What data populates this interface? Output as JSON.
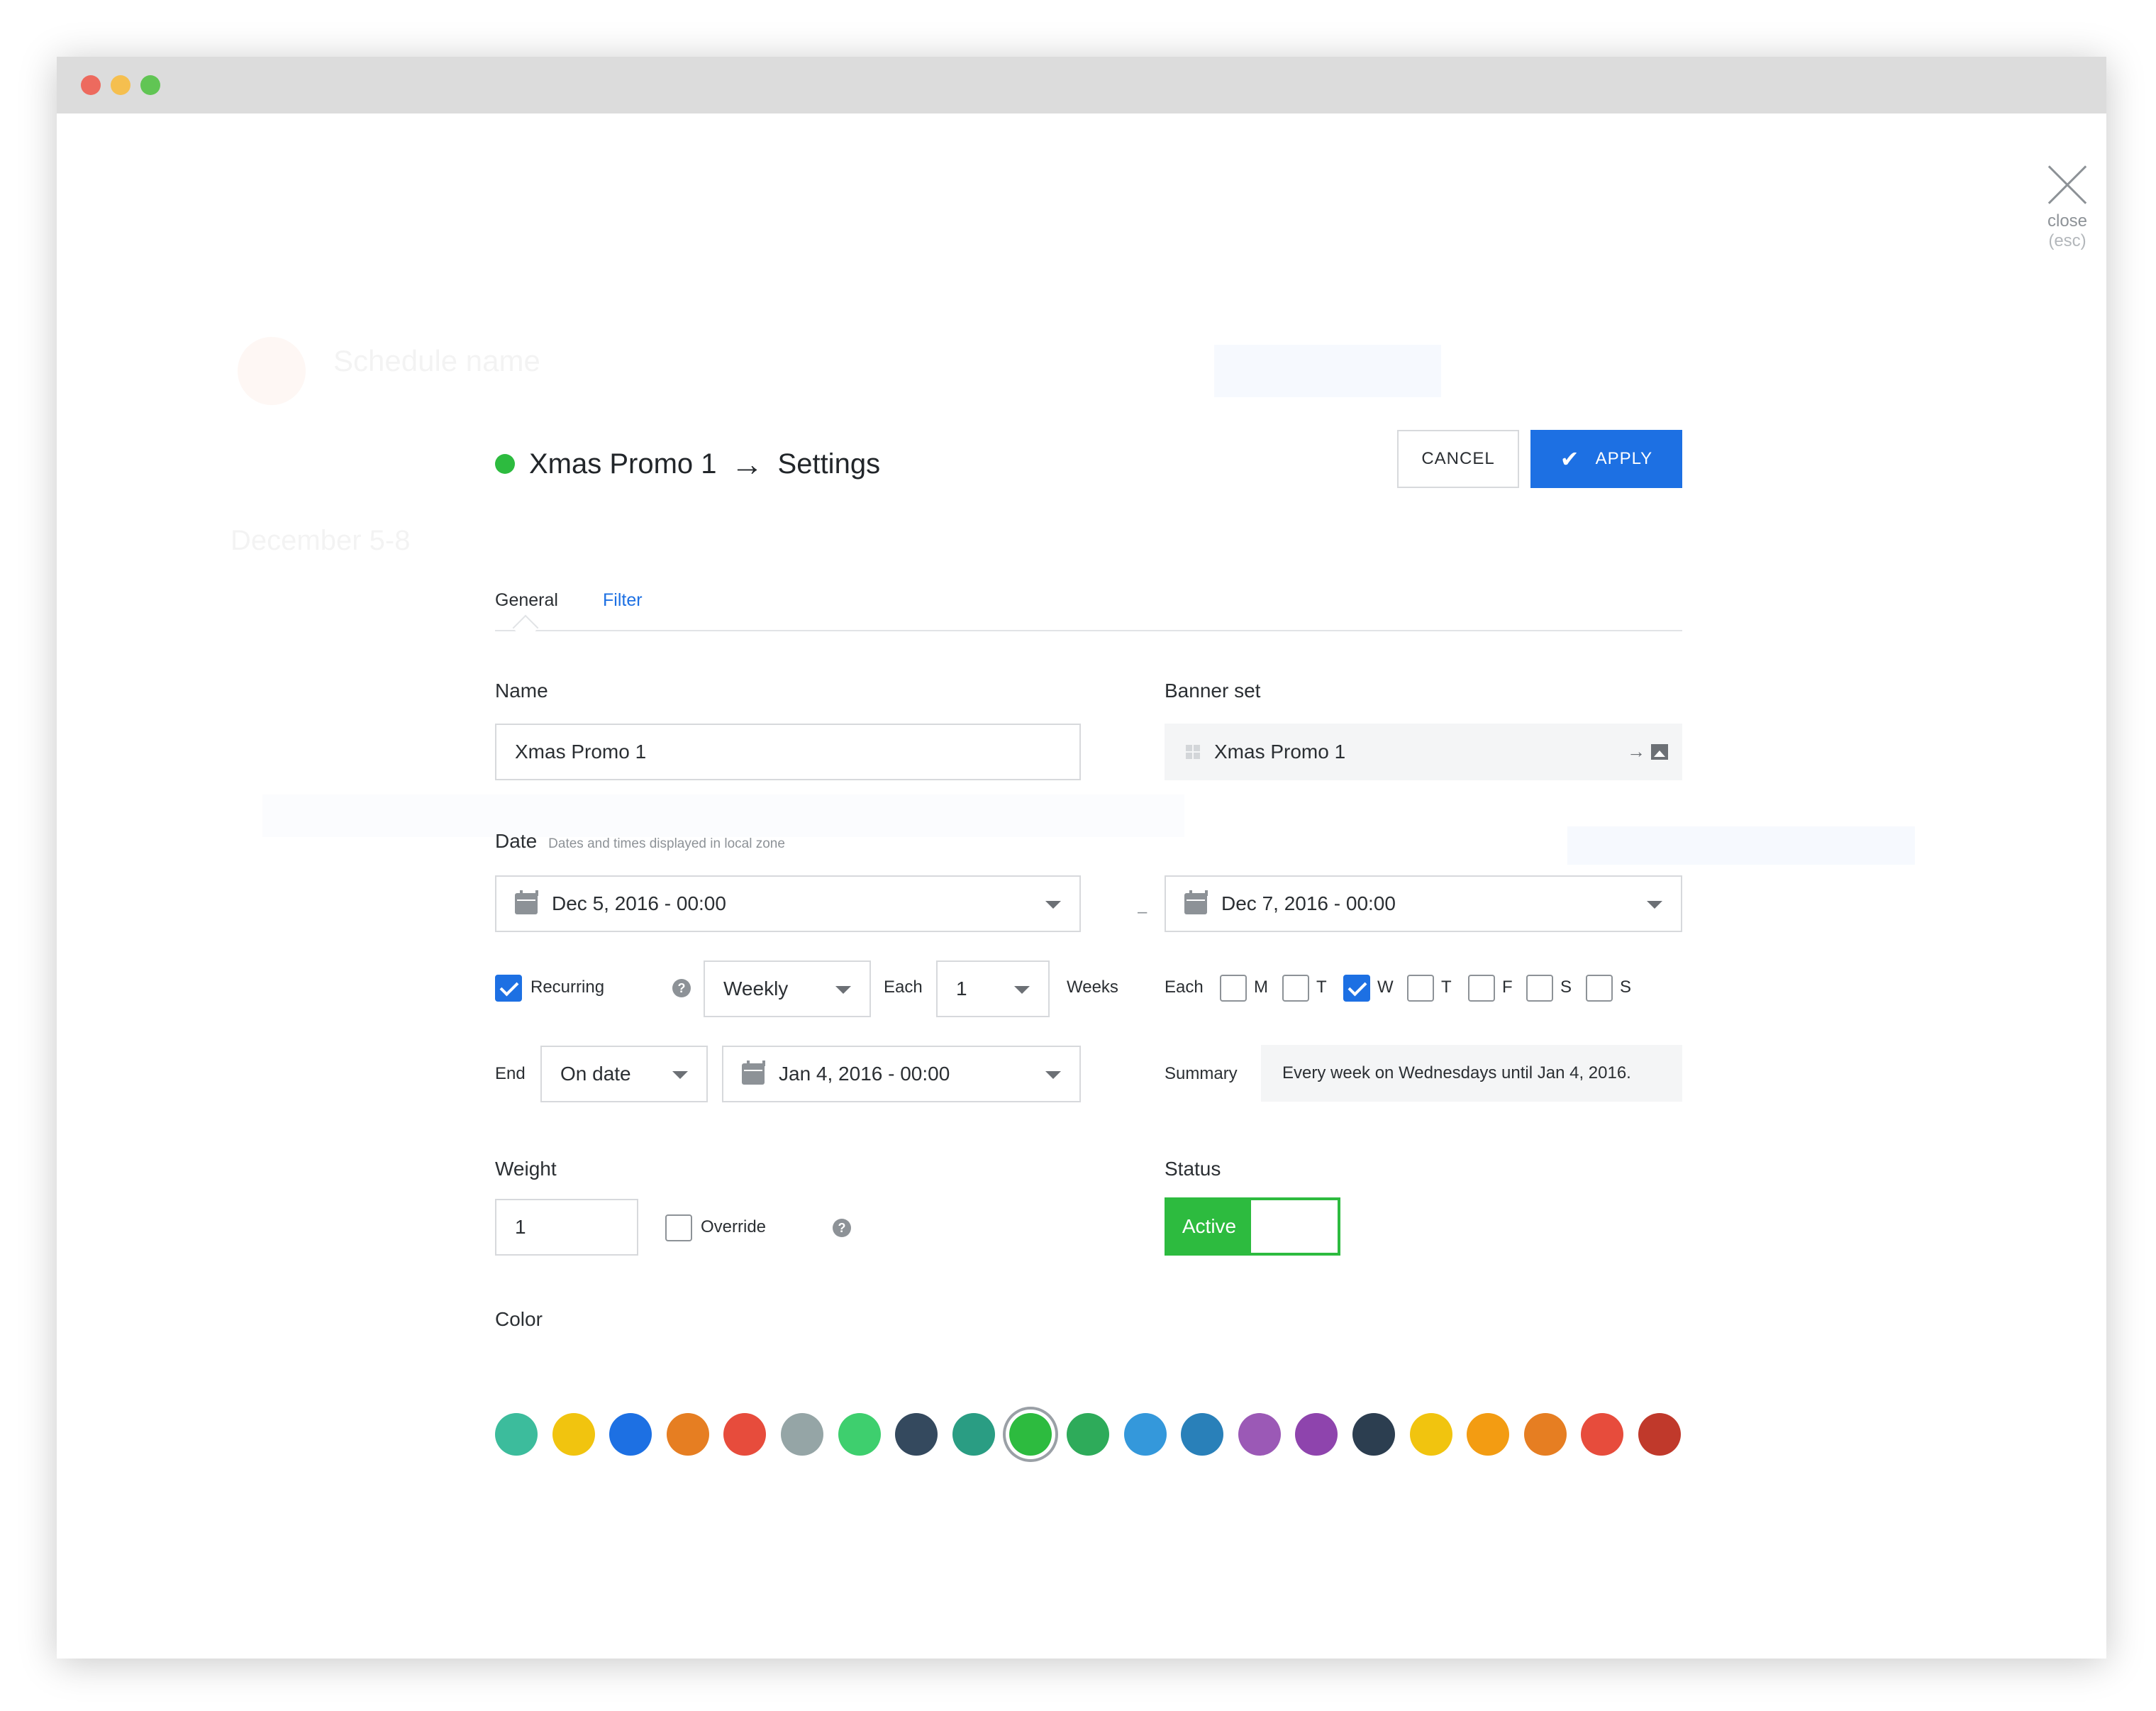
{
  "window": {
    "close_label": "close",
    "close_shortcut": "(esc)"
  },
  "background": {
    "ghost_title": "Schedule name",
    "ghost_subtitle": "December 5-8"
  },
  "modal": {
    "title_campaign": "Xmas Promo 1",
    "title_arrow": "→",
    "title_page": "Settings",
    "status_dot_color": "#2dbb3f",
    "cancel_label": "CANCEL",
    "apply_label": "APPLY"
  },
  "tabs": [
    {
      "label": "General",
      "active": true
    },
    {
      "label": "Filter",
      "active": false
    }
  ],
  "form": {
    "name_label": "Name",
    "name_value": "Xmas Promo 1",
    "banner_set_label": "Banner set",
    "banner_set_value": "Xmas Promo 1",
    "date_label": "Date",
    "date_hint": "Dates and times displayed in local zone",
    "date_start": "Dec 5, 2016 - 00:00",
    "date_separator": "–",
    "date_end": "Dec 7, 2016 - 00:00",
    "recurring_label": "Recurring",
    "recurring_checked": true,
    "frequency_value": "Weekly",
    "each_label": "Each",
    "interval_value": "1",
    "interval_unit": "Weeks",
    "days_each_label": "Each",
    "weekdays": [
      {
        "label": "M",
        "checked": false
      },
      {
        "label": "T",
        "checked": false
      },
      {
        "label": "W",
        "checked": true
      },
      {
        "label": "T",
        "checked": false
      },
      {
        "label": "F",
        "checked": false
      },
      {
        "label": "S",
        "checked": false
      },
      {
        "label": "S",
        "checked": false
      }
    ],
    "end_label": "End",
    "end_mode": "On date",
    "end_date": "Jan 4, 2016 - 00:00",
    "summary_label": "Summary",
    "summary_text": "Every week on Wednesdays until Jan 4, 2016.",
    "weight_label": "Weight",
    "weight_value": "1",
    "override_label": "Override",
    "override_checked": false,
    "status_label": "Status",
    "status_value": "Active",
    "color_label": "Color",
    "help_glyph": "?"
  },
  "colors": [
    {
      "hex": "#3cbc9c",
      "selected": false
    },
    {
      "hex": "#f1c40f",
      "selected": false
    },
    {
      "hex": "#1d70e3",
      "selected": false
    },
    {
      "hex": "#e67e22",
      "selected": false
    },
    {
      "hex": "#e74c3c",
      "selected": false
    },
    {
      "hex": "#95a5a6",
      "selected": false
    },
    {
      "hex": "#3ecf6e",
      "selected": false
    },
    {
      "hex": "#34495e",
      "selected": false
    },
    {
      "hex": "#2a9d83",
      "selected": false
    },
    {
      "hex": "#2dbb3f",
      "selected": true
    },
    {
      "hex": "#2eab5a",
      "selected": false
    },
    {
      "hex": "#3498db",
      "selected": false
    },
    {
      "hex": "#2980b9",
      "selected": false
    },
    {
      "hex": "#9b59b6",
      "selected": false
    },
    {
      "hex": "#8e44ad",
      "selected": false
    },
    {
      "hex": "#2c3e50",
      "selected": false
    },
    {
      "hex": "#f1c40f",
      "selected": false
    },
    {
      "hex": "#f39c12",
      "selected": false
    },
    {
      "hex": "#e67e22",
      "selected": false
    },
    {
      "hex": "#e74c3c",
      "selected": false
    },
    {
      "hex": "#c0392b",
      "selected": false
    }
  ]
}
